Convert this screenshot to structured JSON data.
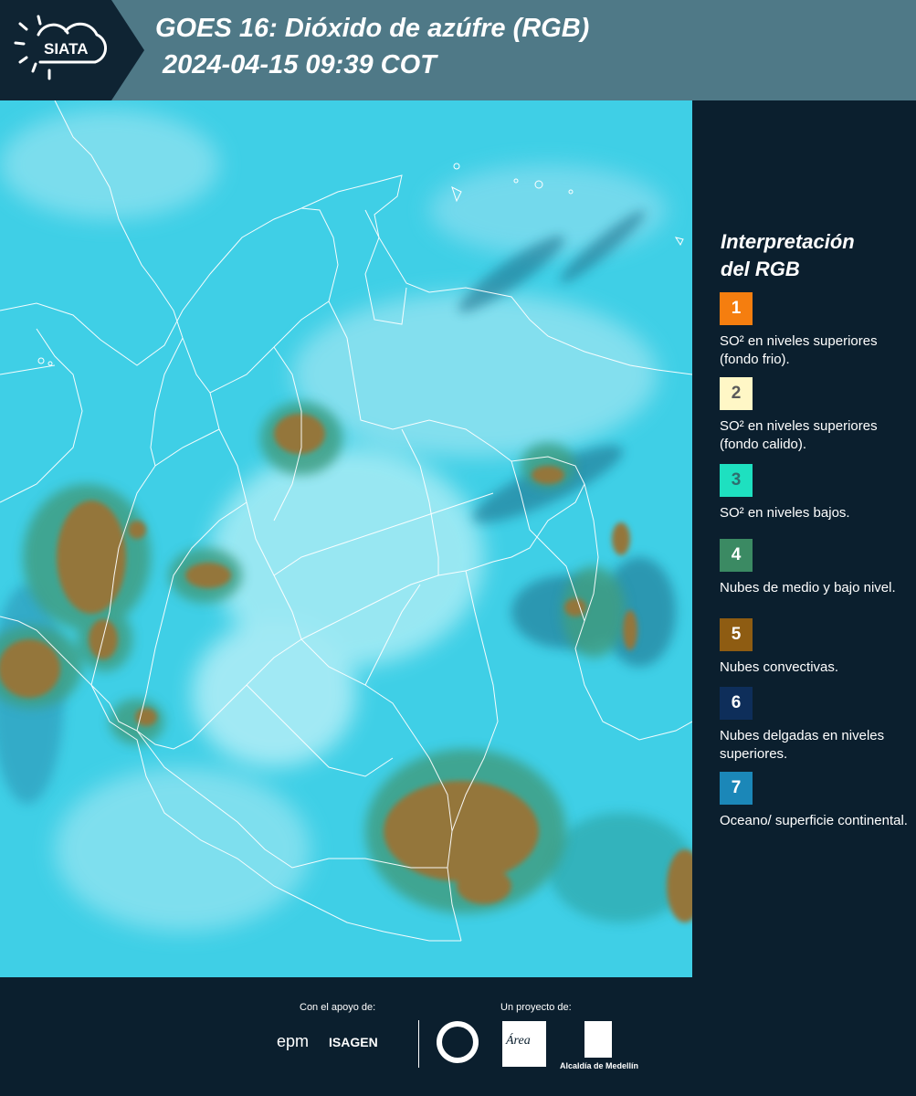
{
  "header": {
    "logo_text": "SIATA",
    "title_line1": "GOES 16: Dióxido de azúfre (RGB)",
    "title_line2": "2024-04-15 09:39 COT"
  },
  "legend": {
    "title_line1": "Interpretación",
    "title_line2": "del RGB",
    "items": [
      {
        "number": "1",
        "color": "#f57e0f",
        "text_color": "#ffffff",
        "label": "SO² en niveles superiores (fondo frio)."
      },
      {
        "number": "2",
        "color": "#fff7c6",
        "text_color": "#5a5a5a",
        "label": "SO² en niveles superiores (fondo calido)."
      },
      {
        "number": "3",
        "color": "#1ee0c0",
        "text_color": "#2e6e6e",
        "label": "SO² en niveles bajos."
      },
      {
        "number": "4",
        "color": "#3b8a63",
        "text_color": "#ffffff",
        "label": "Nubes de medio y bajo nivel."
      },
      {
        "number": "5",
        "color": "#8e5c12",
        "text_color": "#ffffff",
        "label": "Nubes convectivas."
      },
      {
        "number": "6",
        "color": "#0e2e5a",
        "text_color": "#ffffff",
        "label": "Nubes delgadas en niveles superiores."
      },
      {
        "number": "7",
        "color": "#1b87b8",
        "text_color": "#ffffff",
        "label": "Oceano/ superficie continental."
      }
    ]
  },
  "footer": {
    "support_label": "Con el apoyo de:",
    "project_label": "Un proyecto de:",
    "sponsor1": "epm",
    "sponsor2": "ISAGEN",
    "partner_area": "Área",
    "partner_alcaldia": "Alcaldía de Medellín"
  }
}
